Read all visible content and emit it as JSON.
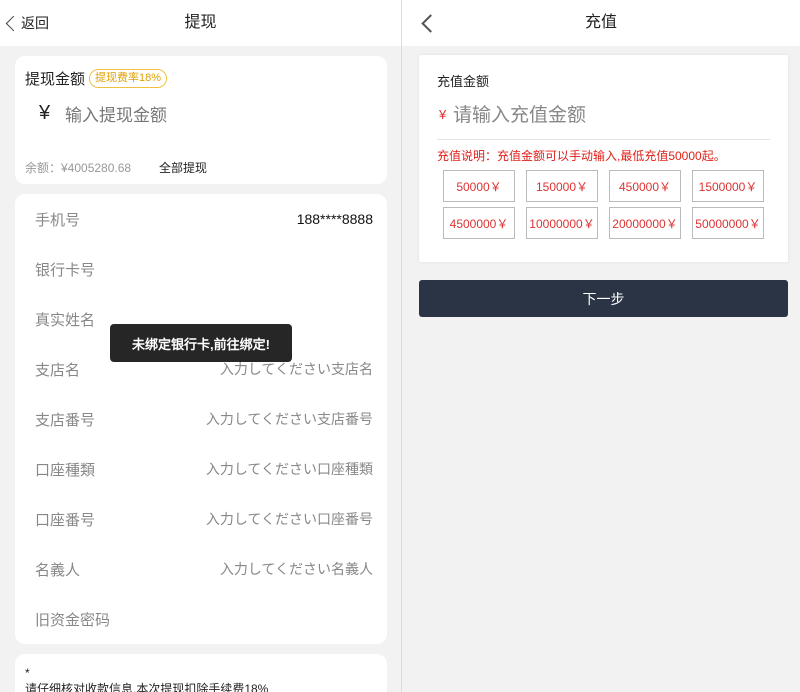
{
  "withdraw": {
    "back_label": "返回",
    "title": "提现",
    "amount_label": "提现金额",
    "fee_badge": "提现费率18%",
    "currency_symbol": "¥",
    "amount_placeholder": "输入提现金额",
    "balance": "余额：¥4005280.68",
    "withdraw_all": "全部提现",
    "fields": [
      {
        "label": "手机号",
        "value": "188****8888"
      },
      {
        "label": "银行卡号",
        "placeholder": ""
      },
      {
        "label": "真实姓名",
        "placeholder": ""
      },
      {
        "label": "支店名",
        "placeholder": "入力してください支店名"
      },
      {
        "label": "支店番号",
        "placeholder": "入力してください支店番号"
      },
      {
        "label": "口座種類",
        "placeholder": "入力してください口座種類"
      },
      {
        "label": "口座番号",
        "placeholder": "入力してください口座番号"
      },
      {
        "label": "名義人",
        "placeholder": "入力してください名義人"
      },
      {
        "label": "旧资金密码",
        "placeholder": ""
      }
    ],
    "note_star": "*",
    "note_text": "请仔细核对收款信息,本次提现扣除手续费18%",
    "toast": "未绑定银行卡,前往绑定!"
  },
  "recharge": {
    "title": "充值",
    "amount_label": "充值金额",
    "currency_symbol": "¥",
    "amount_placeholder": "请输入充值金额",
    "hint": "充值说明：充值金额可以手动输入,最低充值50000起。",
    "options": [
      "50000￥",
      "150000￥",
      "450000￥",
      "1500000￥",
      "4500000￥",
      "10000000￥",
      "20000000￥",
      "50000000￥"
    ],
    "next_label": "下一步"
  },
  "colors": {
    "accent_red": "#e0201a",
    "button_dark": "#2b3445",
    "badge_gold": "#e0a100"
  }
}
